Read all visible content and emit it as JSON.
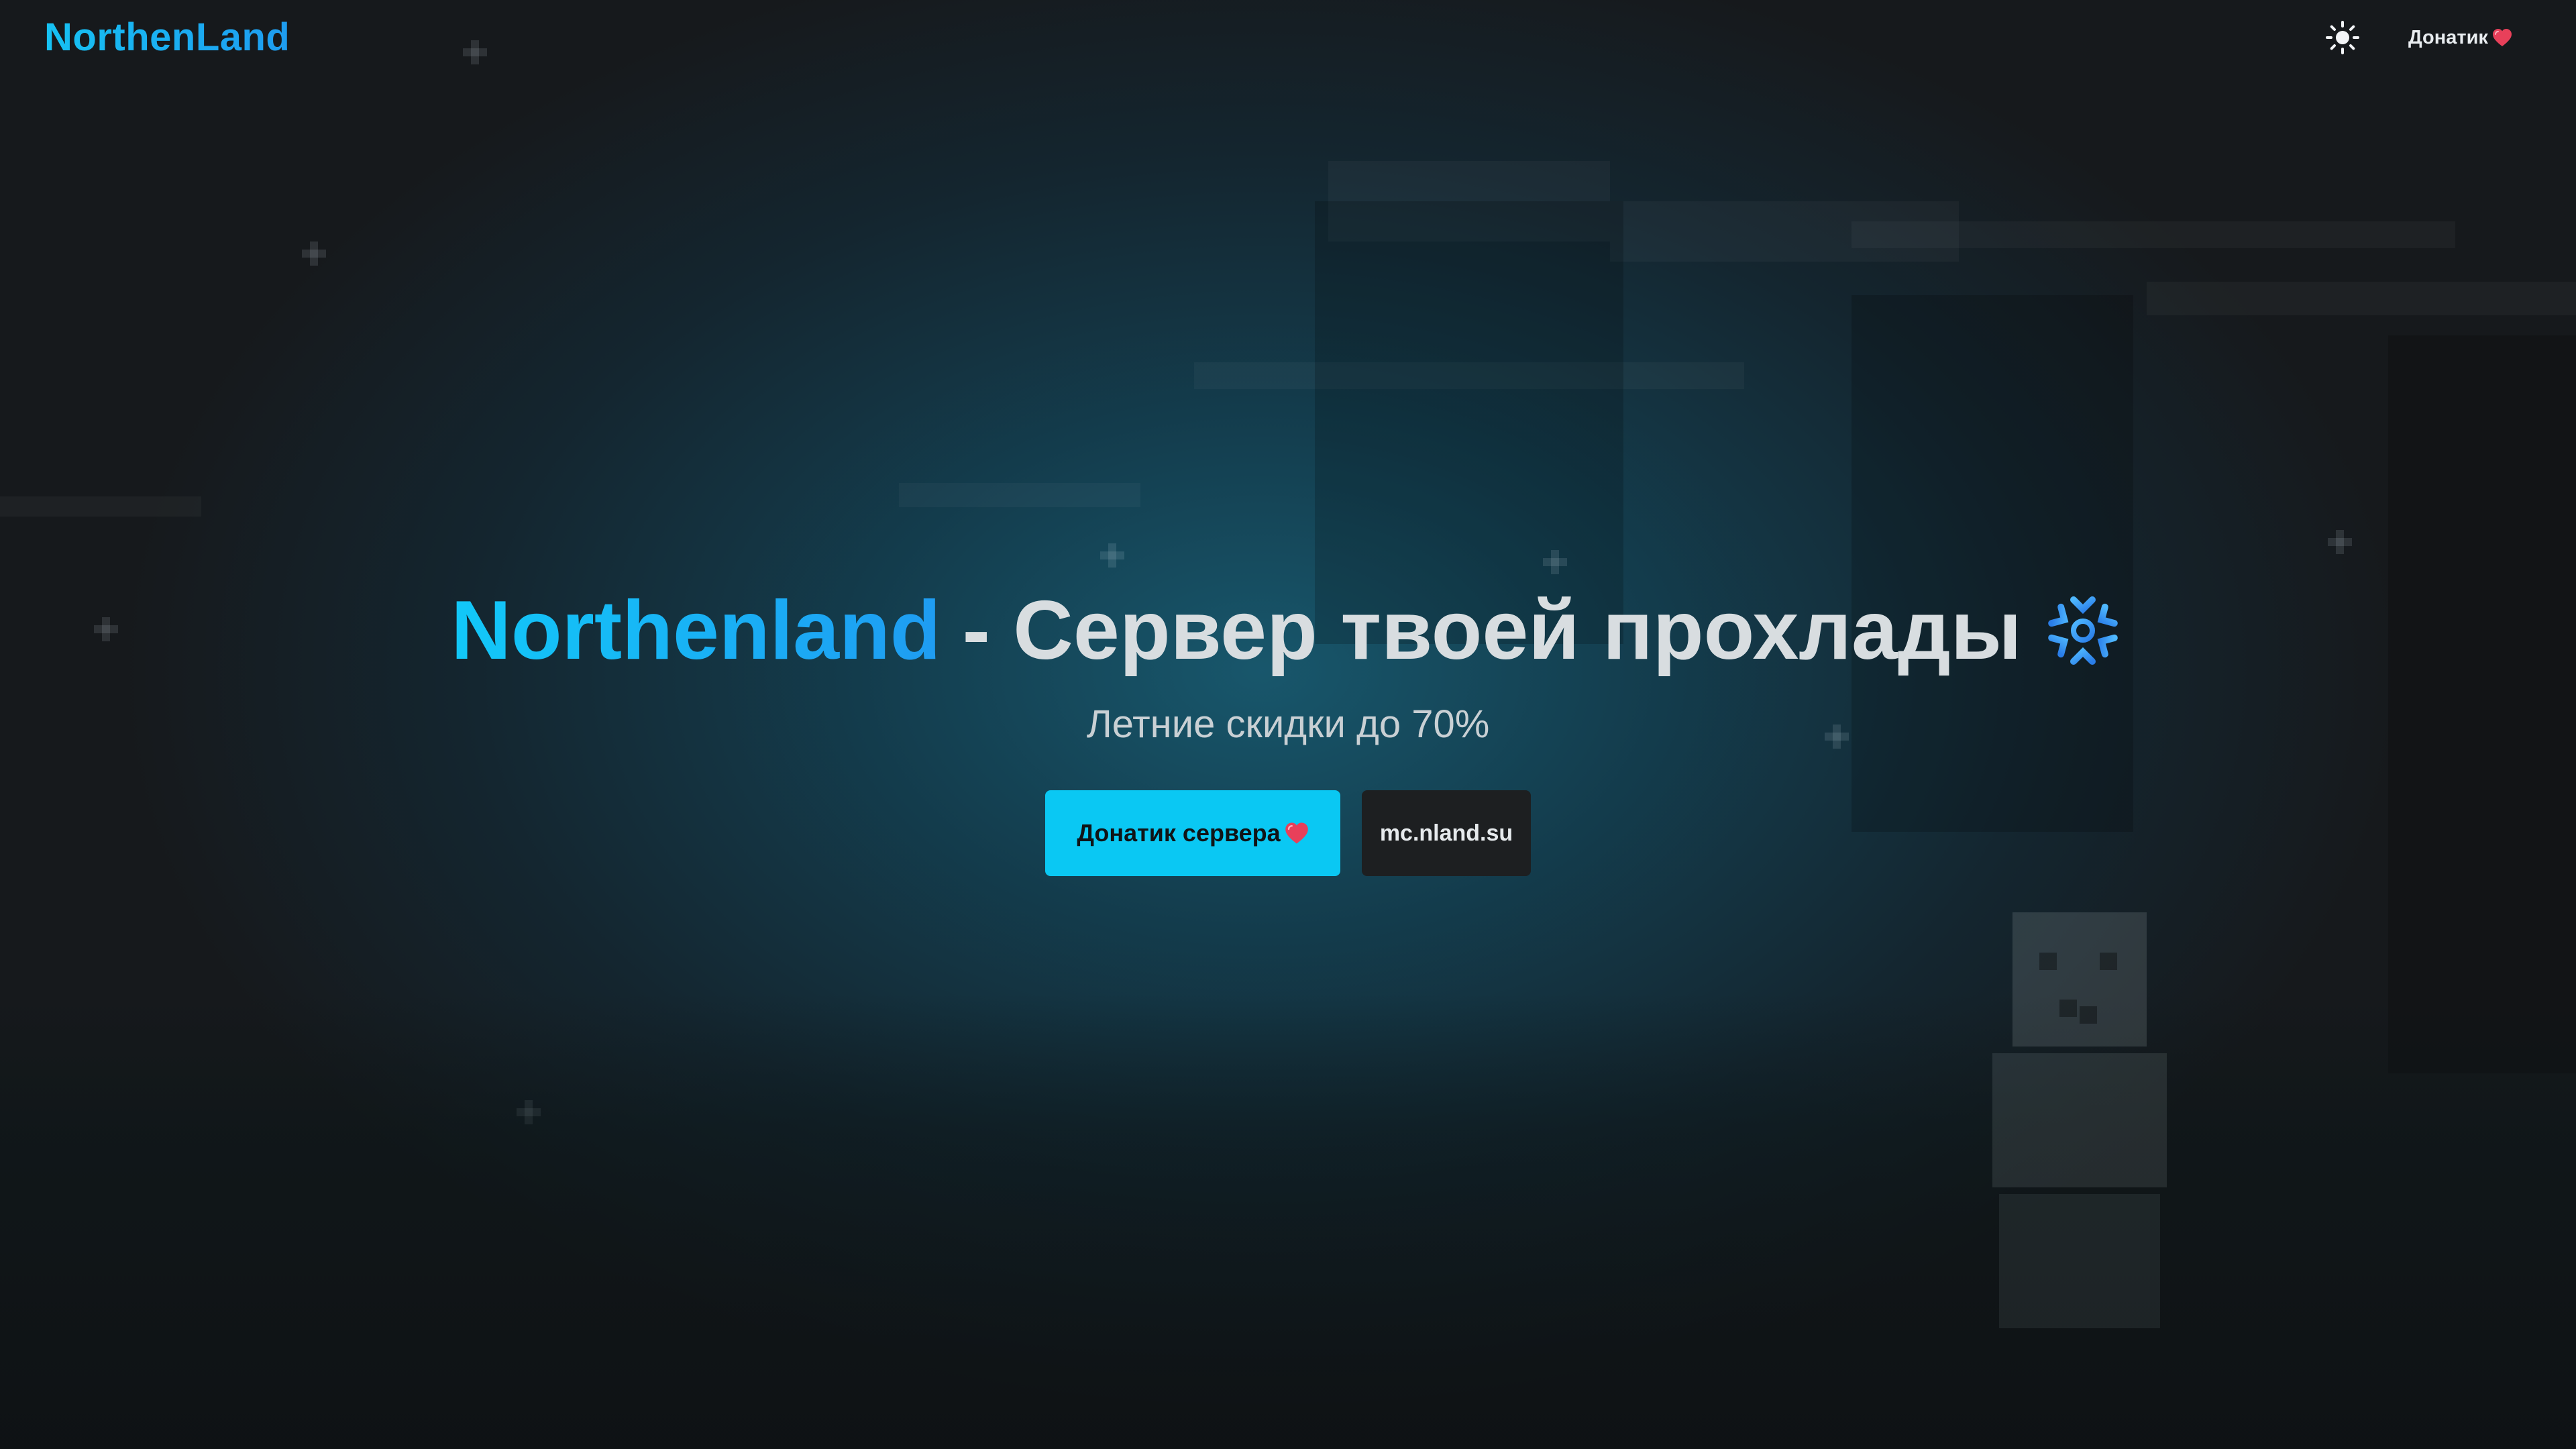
{
  "header": {
    "logo": "NorthenLand",
    "theme_toggle_icon": "sun-icon",
    "nav_donate_label": "Донатик"
  },
  "hero": {
    "title_brand": "Northenland",
    "title_rest": "- Сервер твоей прохлады",
    "title_icon": "snowflake-icon",
    "subtitle": "Летние скидки до 70%",
    "primary_button_label": "Донатик сервера",
    "secondary_button_label": "mc.nland.su"
  },
  "colors": {
    "accent": "#0ac8f3",
    "brand_gradient_start": "#12c8f8",
    "brand_gradient_end": "#1f9cf2",
    "heart": "#e8405a",
    "secondary_button_bg": "#1d1f21"
  }
}
